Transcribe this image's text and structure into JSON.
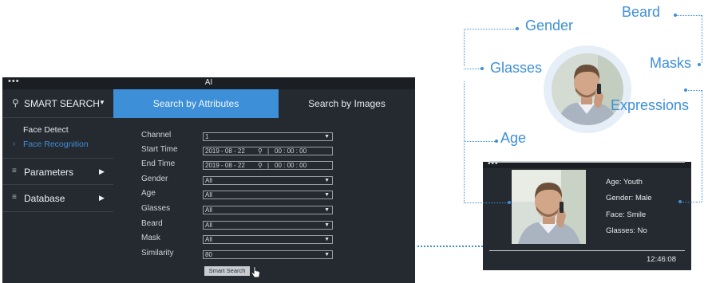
{
  "main_window": {
    "title": "AI",
    "dots": "•••",
    "sidebar": {
      "smart_search": "SMART SEARCH",
      "face_detect": "Face Detect",
      "face_recognition": "Face Recognition",
      "parameters": "Parameters",
      "database": "Database"
    },
    "tabs": {
      "attributes": "Search by Attributes",
      "images": "Search by Images"
    },
    "form": {
      "channel": {
        "label": "Channel",
        "value": "1"
      },
      "start_time": {
        "label": "Start Time",
        "date": "2019 - 08 - 22",
        "time": "00 : 00 : 00"
      },
      "end_time": {
        "label": "End Time",
        "date": "2019 - 08 - 22",
        "time": "00 : 00 : 00"
      },
      "gender": {
        "label": "Gender",
        "value": "All"
      },
      "age": {
        "label": "Age",
        "value": "All"
      },
      "glasses": {
        "label": "Glasses",
        "value": "All"
      },
      "beard": {
        "label": "Beard",
        "value": "All"
      },
      "mask": {
        "label": "Mask",
        "value": "All"
      },
      "similarity": {
        "label": "Similarity",
        "value": "80"
      },
      "smart_search_button": "Smart Search"
    }
  },
  "attributes_diagram": {
    "gender": "Gender",
    "beard": "Beard",
    "glasses": "Glasses",
    "masks": "Masks",
    "age": "Age",
    "expressions": "Expressions"
  },
  "result_window": {
    "dots": "•••",
    "age": "Age: Youth",
    "gender": "Gender: Male",
    "face": "Face: Smile",
    "glasses": "Glasses: No",
    "time": "12:46:08"
  },
  "colors": {
    "accent": "#3d8fd8",
    "window_bg": "#252a30",
    "titlebar_bg": "#1b1f24"
  }
}
